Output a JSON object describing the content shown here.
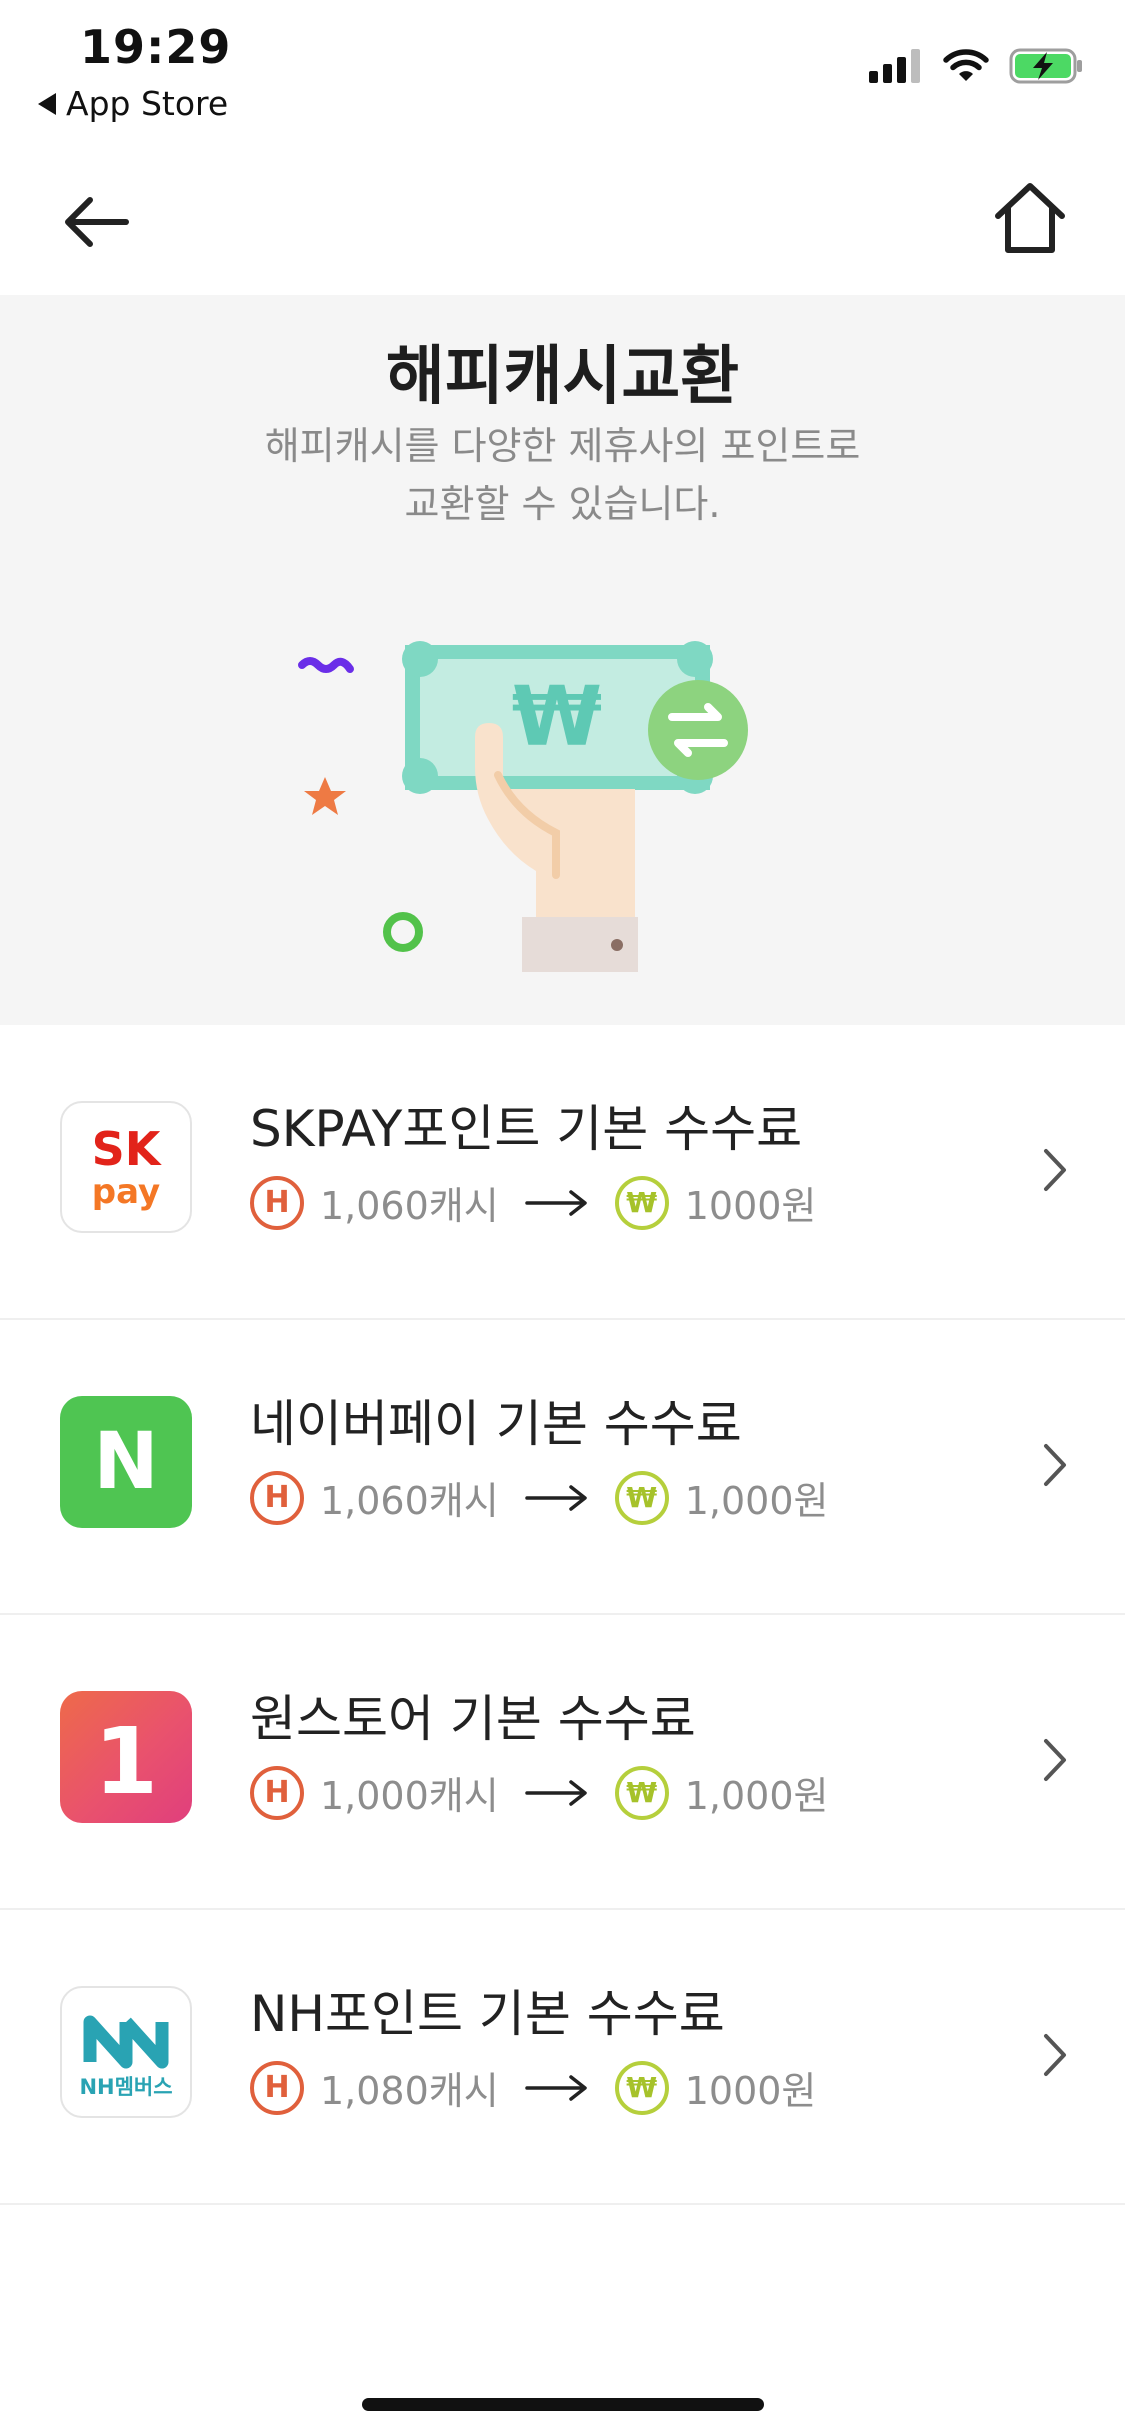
{
  "status_bar": {
    "time": "19:29",
    "back_app_label": "App Store"
  },
  "hero": {
    "title": "해피캐시교환",
    "subtitle_line1": "해피캐시를 다양한 제휴사의 포인트로",
    "subtitle_line2": "교환할 수 있습니다."
  },
  "badges": {
    "cash_symbol": "H",
    "won_symbol": "₩"
  },
  "partners": [
    {
      "name": "SKPAY포인트 기본 수수료",
      "from_amount": "1,060캐시",
      "to_amount": "1000원",
      "logo_text_top": "SK",
      "logo_text_bottom": "pay"
    },
    {
      "name": "네이버페이 기본 수수료",
      "from_amount": "1,060캐시",
      "to_amount": "1,000원",
      "logo_text": "N"
    },
    {
      "name": "원스토어 기본 수수료",
      "from_amount": "1,000캐시",
      "to_amount": "1,000원",
      "logo_text": "1"
    },
    {
      "name": "NH포인트 기본 수수료",
      "from_amount": "1,080캐시",
      "to_amount": "1000원",
      "logo_text": "NH멤버스"
    }
  ],
  "colors": {
    "cash_badge": "#e0603c",
    "won_badge": "#b5cf3c",
    "naver_green": "#4fc552",
    "onestore_pink": "#e9526d",
    "sk_red": "#e2231a",
    "sk_orange": "#f47725",
    "nh_teal": "#29a3b3",
    "hero_bg": "#f5f5f5"
  }
}
